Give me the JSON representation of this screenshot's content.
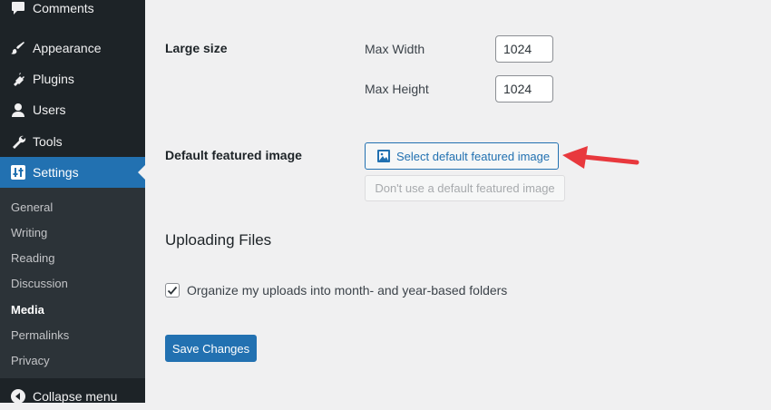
{
  "sidebar": {
    "items": [
      {
        "label": "Comments",
        "icon": "comments-icon"
      },
      {
        "label": "Appearance",
        "icon": "paintbrush-icon"
      },
      {
        "label": "Plugins",
        "icon": "plug-icon"
      },
      {
        "label": "Users",
        "icon": "user-icon"
      },
      {
        "label": "Tools",
        "icon": "wrench-icon"
      },
      {
        "label": "Settings",
        "icon": "settings-sliders-icon"
      }
    ],
    "submenu": [
      "General",
      "Writing",
      "Reading",
      "Discussion",
      "Media",
      "Permalinks",
      "Privacy"
    ],
    "active_submenu": "Media",
    "collapse_label": "Collapse menu"
  },
  "large_size": {
    "label": "Large size",
    "max_width_label": "Max Width",
    "max_width_value": "1024",
    "max_height_label": "Max Height",
    "max_height_value": "1024"
  },
  "featured_image": {
    "label": "Default featured image",
    "select_button": "Select default featured image",
    "dont_use_button": "Don't use a default featured image"
  },
  "uploading": {
    "title": "Uploading Files",
    "organize_label": "Organize my uploads into month- and year-based folders",
    "organize_checked": true
  },
  "save_button": "Save Changes",
  "colors": {
    "sidebar_bg": "#1d2327",
    "accent": "#2271b1",
    "annotation_arrow": "#e8383d"
  }
}
